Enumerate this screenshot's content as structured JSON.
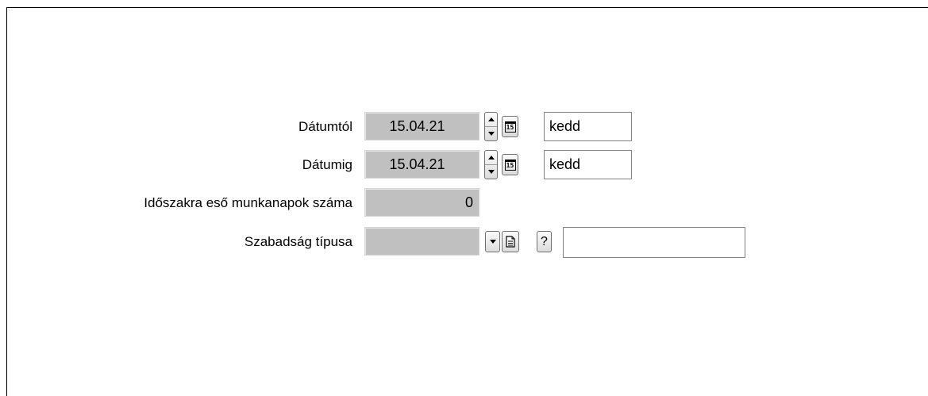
{
  "form": {
    "date_from": {
      "label": "Dátumtól",
      "value": "15.04.21",
      "weekday": "kedd"
    },
    "date_to": {
      "label": "Dátumig",
      "value": "15.04.21",
      "weekday": "kedd"
    },
    "workdays": {
      "label": "Időszakra eső munkanapok száma",
      "value": "0"
    },
    "leave_type": {
      "label": "Szabadság típusa",
      "value": "",
      "text_value": ""
    },
    "icons": {
      "spin": "spinner-icon",
      "calendar": "calendar-icon",
      "calendar_number": "15",
      "dropdown": "chevron-down-icon",
      "details": "document-icon",
      "help": "?"
    }
  }
}
